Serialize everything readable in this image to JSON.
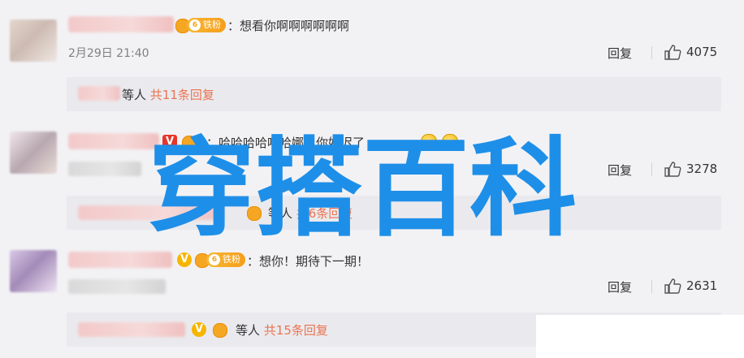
{
  "comments": [
    {
      "text": "：想看你啊啊啊啊啊啊",
      "fan_badge": "铁粉",
      "fan_level": "6",
      "time": "2月29日 21:40",
      "reply_label": "回复",
      "likes": "4075",
      "sub": {
        "suffix": "等人",
        "link": "共11条回复"
      }
    },
    {
      "text": "：哈哈哈哈哈哈娜姐你好迟了",
      "reply_label": "回复",
      "likes": "3278",
      "sub": {
        "suffix": "等人",
        "link": "共6条回复"
      }
    },
    {
      "text": "：想你！期待下一期！",
      "fan_badge": "铁粉",
      "fan_level": "6",
      "reply_label": "回复",
      "likes": "2631",
      "sub": {
        "suffix": "等人",
        "link": "共15条回复"
      }
    }
  ],
  "badges": {
    "v": "V",
    "verified_red": "V"
  },
  "watermark": "穿搭百科",
  "colors": {
    "link": "#eb7350",
    "watermark": "#1e8fe8",
    "badge": "#f7b500"
  }
}
